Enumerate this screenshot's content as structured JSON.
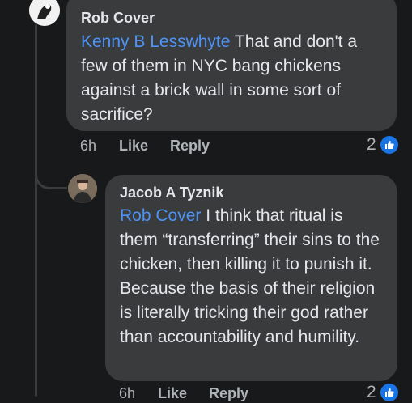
{
  "comments": [
    {
      "author": "Rob Cover",
      "mention": "Kenny B Lesswhyte",
      "text": " That and don't a few of them in NYC bang chickens against a brick wall in some sort of sacrifice?",
      "time": "6h",
      "like_label": "Like",
      "reply_label": "Reply",
      "reaction_count": "2"
    },
    {
      "author": "Jacob A Tyznik",
      "mention": "Rob Cover",
      "text": " I think that ritual is them “transferring” their sins to the chicken, then killing it to punish it. Because the basis of their religion is literally tricking their god rather than accountability and humility.",
      "time": "6h",
      "like_label": "Like",
      "reply_label": "Reply",
      "reaction_count": "2"
    }
  ],
  "colors": {
    "bubble": "#3a3b3c",
    "mention": "#4e93f5",
    "like": "#1b74e4"
  }
}
